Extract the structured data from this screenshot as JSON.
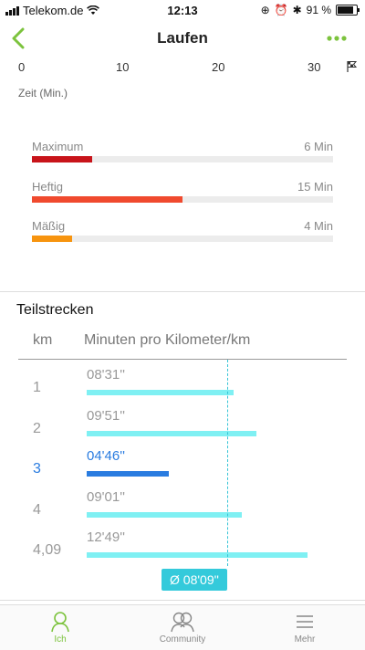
{
  "status_bar": {
    "carrier": "Telekom.de",
    "time": "12:13",
    "battery": "91 %",
    "battery_level": 0.91
  },
  "nav": {
    "title": "Laufen",
    "back_icon": "chevron-left-icon",
    "more_icon": "ellipsis-icon"
  },
  "axis": {
    "ticks": [
      "0",
      "10",
      "20",
      "30"
    ],
    "end_icon": "finish-flag-icon",
    "time_label": "Zeit (Min.)"
  },
  "intensity": [
    {
      "label": "Maximum",
      "value": "6 Min",
      "minutes": 6,
      "color": "#c8141a"
    },
    {
      "label": "Heftig",
      "value": "15 Min",
      "minutes": 15,
      "color": "#f04a2e"
    },
    {
      "label": "Mäßig",
      "value": "4 Min",
      "minutes": 4,
      "color": "#f7940f"
    }
  ],
  "splits": {
    "title": "Teilstrecken",
    "col_km": "km",
    "col_minutes": "Minuten pro Kilometer/km",
    "rows": [
      {
        "km": "1",
        "time": "08'31''",
        "seconds": 511,
        "active": false
      },
      {
        "km": "2",
        "time": "09'51''",
        "seconds": 591,
        "active": false
      },
      {
        "km": "3",
        "time": "04'46''",
        "seconds": 286,
        "active": true
      },
      {
        "km": "4",
        "time": "09'01''",
        "seconds": 541,
        "active": false
      },
      {
        "km": "4,09",
        "time": "12'49''",
        "seconds": 769,
        "active": false
      }
    ],
    "average": "Ø 08'09''",
    "average_seconds": 489,
    "bar_color": "#7ff0f3",
    "active_color": "#2a7ce0",
    "average_color": "#34cadb"
  },
  "tabs": [
    {
      "label": "Ich",
      "icon": "person-icon",
      "active": true
    },
    {
      "label": "Community",
      "icon": "community-icon",
      "active": false
    },
    {
      "label": "Mehr",
      "icon": "menu-icon",
      "active": false
    }
  ],
  "accent_color": "#7cc33d"
}
